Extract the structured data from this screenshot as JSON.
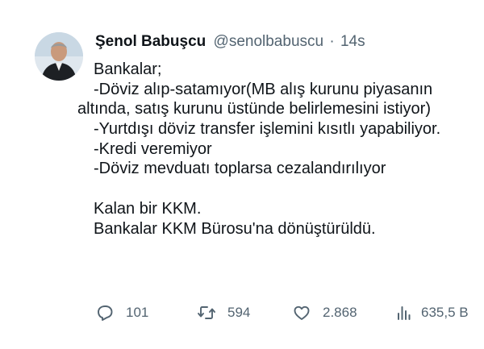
{
  "author": {
    "name": "Şenol Babuşcu",
    "handle": "@senolbabuscu",
    "separator": "·",
    "time": "14s"
  },
  "tweet": {
    "lines": [
      "Bankalar;",
      "-Döviz alıp-satamıyor(MB alış kurunu piyasanın",
      "altında, satış kurunu üstünde belirlemesini istiyor)",
      "-Yurtdışı döviz transfer işlemini kısıtlı yapabiliyor.",
      "-Kredi veremiyor",
      "-Döviz mevduatı toplarsa cezalandırılıyor",
      "",
      "Kalan bir KKM.",
      "Bankalar KKM Bürosu'na dönüştürüldü."
    ]
  },
  "actions": {
    "replies": "101",
    "retweets": "594",
    "likes": "2.868",
    "views": "635,5 B"
  },
  "icons": {
    "reply": "reply-icon",
    "retweet": "retweet-icon",
    "like": "heart-icon",
    "views": "views-icon"
  },
  "colors": {
    "text": "#0f1419",
    "secondary": "#536471",
    "background": "#ffffff"
  }
}
